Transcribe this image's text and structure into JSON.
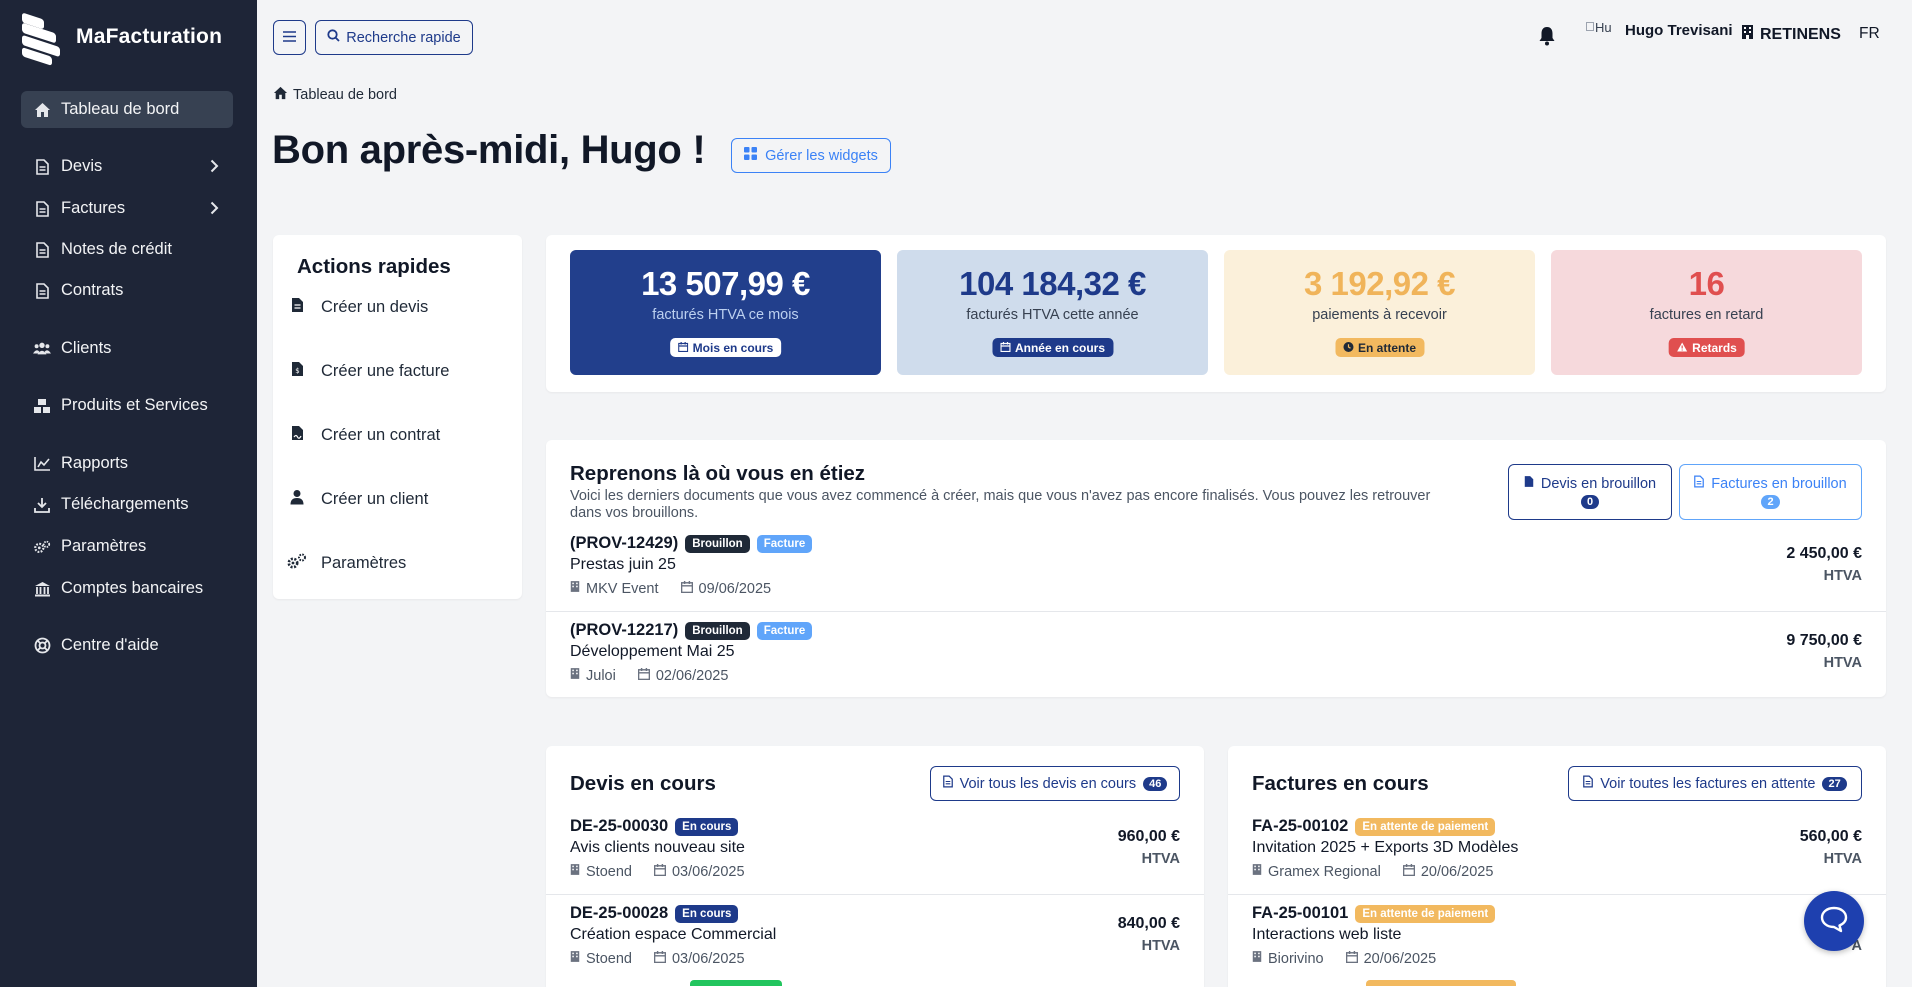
{
  "app": {
    "name": "MaFacturation"
  },
  "sidebar": {
    "items": [
      {
        "label": "Tableau de bord",
        "icon": "home-icon"
      },
      {
        "label": "Devis",
        "icon": "file-icon"
      },
      {
        "label": "Factures",
        "icon": "file-icon"
      },
      {
        "label": "Notes de crédit",
        "icon": "file-icon"
      },
      {
        "label": "Contrats",
        "icon": "file-icon"
      },
      {
        "label": "Clients",
        "icon": "users-icon"
      },
      {
        "label": "Produits et Services",
        "icon": "boxes-icon"
      },
      {
        "label": "Rapports",
        "icon": "chart-icon"
      },
      {
        "label": "Téléchargements",
        "icon": "download-icon"
      },
      {
        "label": "Paramètres",
        "icon": "gears-icon"
      },
      {
        "label": "Comptes bancaires",
        "icon": "bank-icon"
      },
      {
        "label": "Centre d'aide",
        "icon": "lifebuoy-icon"
      }
    ]
  },
  "topbar": {
    "search_label": "Recherche rapide",
    "avatar_alt": "Hu",
    "user_name": "Hugo Trevisani",
    "company": "RETINENS",
    "language": "FR"
  },
  "breadcrumb": "Tableau de bord",
  "greeting": "Bon après-midi, Hugo !",
  "widgets_button": "Gérer les widgets",
  "quick_actions": {
    "title": "Actions rapides",
    "items": [
      "Créer un devis",
      "Créer une facture",
      "Créer un contrat",
      "Créer un client",
      "Paramètres"
    ]
  },
  "stats": [
    {
      "value": "13 507,99 €",
      "label": "facturés HTVA ce mois",
      "badge": "Mois en cours",
      "bg": "#223f8c",
      "fg": "#ffffff",
      "label_color": "#bcd0f0",
      "badge_bg": "#ffffff",
      "badge_fg": "#1e3a8a"
    },
    {
      "value": "104 184,32 €",
      "label": "facturés HTVA cette année",
      "badge": "Année en cours",
      "bg": "#cfdcec",
      "fg": "#1e3a8a",
      "label_color": "#374151",
      "badge_bg": "#1e3a8a",
      "badge_fg": "#ffffff"
    },
    {
      "value": "3 192,92 €",
      "label": "paiements à recevoir",
      "badge": "En attente",
      "bg": "#fbf0da",
      "fg": "#f0b45a",
      "label_color": "#374151",
      "badge_bg": "#f2b95f",
      "badge_fg": "#1f2937"
    },
    {
      "value": "16",
      "label": "factures en retard",
      "badge": "Retards",
      "bg": "#f6d9dc",
      "fg": "#e04f4f",
      "label_color": "#374151",
      "badge_bg": "#e04f4f",
      "badge_fg": "#ffffff"
    }
  ],
  "resume": {
    "title": "Reprenons là où vous en étiez",
    "description": "Voici les derniers documents que vous avez commencé à créer, mais que vous n'avez pas encore finalisés. Vous pouvez les retrouver dans vos brouillons.",
    "drafts_quotes": {
      "label": "Devis en brouillon",
      "count": "0"
    },
    "drafts_invoices": {
      "label": "Factures en brouillon",
      "count": "2"
    },
    "rows": [
      {
        "id": "(PROV-12429)",
        "badges": [
          "Brouillon",
          "Facture"
        ],
        "title": "Prestas juin 25",
        "client": "MKV Event",
        "date": "09/06/2025",
        "amount": "2 450,00 €",
        "htva": "HTVA"
      },
      {
        "id": "(PROV-12217)",
        "badges": [
          "Brouillon",
          "Facture"
        ],
        "title": "Développement Mai 25",
        "client": "Juloi",
        "date": "02/06/2025",
        "amount": "9 750,00 €",
        "htva": "HTVA"
      }
    ]
  },
  "quotes": {
    "title": "Devis en cours",
    "button": "Voir tous les devis en cours",
    "count": "46",
    "rows": [
      {
        "id": "DE-25-00030",
        "badge": "En cours",
        "title": "Avis clients nouveau site",
        "client": "Stoend",
        "date": "03/06/2025",
        "amount": "960,00 €",
        "htva": "HTVA"
      },
      {
        "id": "DE-25-00028",
        "badge": "En cours",
        "title": "Création espace Commercial",
        "client": "Stoend",
        "date": "03/06/2025",
        "amount": "840,00 €",
        "htva": "HTVA"
      }
    ]
  },
  "invoices": {
    "title": "Factures en cours",
    "button": "Voir toutes les factures en attente",
    "count": "27",
    "rows": [
      {
        "id": "FA-25-00102",
        "badge": "En attente de paiement",
        "title": "Invitation 2025 + Exports 3D Modèles",
        "client": "Gramex Regional",
        "date": "20/06/2025",
        "amount": "560,00 €",
        "htva": "HTVA"
      },
      {
        "id": "FA-25-00101",
        "badge": "En attente de paiement",
        "title": "Interactions web liste",
        "client": "Biorivino",
        "date": "20/06/2025",
        "amount": "9",
        "htva": "A"
      }
    ]
  }
}
